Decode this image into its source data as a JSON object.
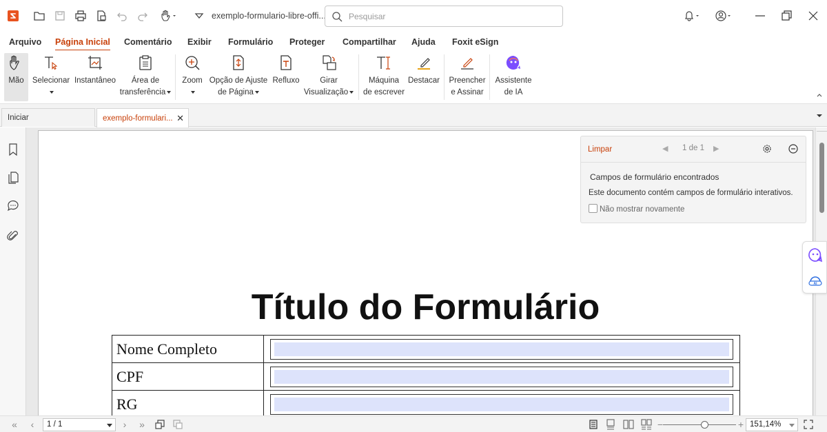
{
  "titlebar": {
    "doc_title": "exemplo-formulario-libre-offi...",
    "search_placeholder": "Pesquisar"
  },
  "menu": {
    "tabs": [
      {
        "label": "Arquivo",
        "active": false
      },
      {
        "label": "Página Inicial",
        "active": true
      },
      {
        "label": "Comentário",
        "active": false
      },
      {
        "label": "Exibir",
        "active": false
      },
      {
        "label": "Formulário",
        "active": false
      },
      {
        "label": "Proteger",
        "active": false
      },
      {
        "label": "Compartilhar",
        "active": false
      },
      {
        "label": "Ajuda",
        "active": false
      },
      {
        "label": "Foxit eSign",
        "active": false
      }
    ]
  },
  "ribbon": {
    "mao": "Mão",
    "selecionar": "Selecionar",
    "instantaneo": "Instantâneo",
    "area_l1": "Área de",
    "area_l2": "transferência",
    "zoom": "Zoom",
    "ajuste_l1": "Opção de Ajuste",
    "ajuste_l2": "de Página",
    "refluxo": "Refluxo",
    "girar_l1": "Girar",
    "girar_l2": "Visualização",
    "maquina_l1": "Máquina",
    "maquina_l2": "de escrever",
    "destacar": "Destacar",
    "preencher_l1": "Preencher",
    "preencher_l2": "e Assinar",
    "assistente_l1": "Assistente",
    "assistente_l2": "de IA"
  },
  "doc_tabs": {
    "home": "Iniciar",
    "current": "exemplo-formulari..."
  },
  "notice": {
    "clear": "Limpar",
    "count": "1 de 1",
    "heading": "Campos de formulário encontrados",
    "body": "Este documento contém campos de formulário interativos.",
    "checkbox_label": "Não mostrar novamente"
  },
  "document": {
    "title": "Título do Formulário",
    "rows": [
      {
        "label": "Nome Completo"
      },
      {
        "label": "CPF"
      },
      {
        "label": "RG"
      }
    ]
  },
  "statusbar": {
    "page": "1 / 1",
    "zoom": "151,14%"
  },
  "colors": {
    "accent": "#c8410b",
    "field_fill": "#dde3fb",
    "ai_purple": "#7b4dff"
  }
}
